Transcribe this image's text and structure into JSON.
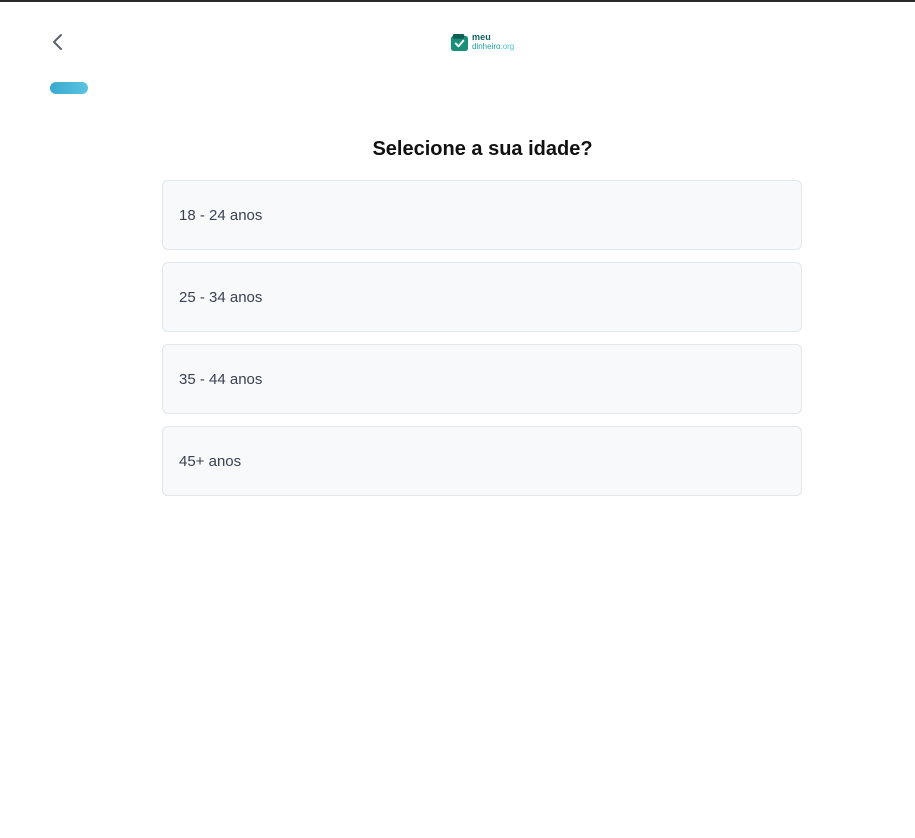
{
  "header": {
    "back_icon": "chevron-left-icon",
    "logo": {
      "top": "meu",
      "bottom_main": "dinheiro",
      "bottom_suffix": ".org"
    }
  },
  "progress": {
    "value": 0.06,
    "color": "#3aa9cf"
  },
  "question": {
    "title": "Selecione a sua idade?"
  },
  "options": [
    {
      "label": "18 - 24 anos"
    },
    {
      "label": "25 - 34 anos"
    },
    {
      "label": "35 - 44 anos"
    },
    {
      "label": "45+ anos"
    }
  ],
  "colors": {
    "accent": "#3aa9cf",
    "brand_dark": "#0f5f57",
    "brand": "#18a19b"
  }
}
